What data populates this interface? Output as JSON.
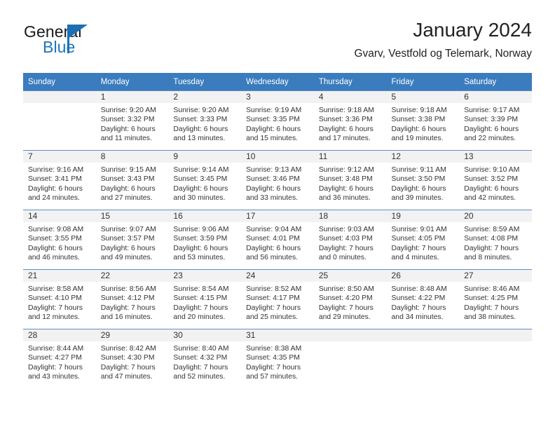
{
  "brand": {
    "name_part1": "General",
    "name_part2": "Blue",
    "logo_icon": "triangle-flag-icon",
    "accent_color": "#1b6fb5"
  },
  "header": {
    "title": "January 2024",
    "subtitle": "Gvarv, Vestfold og Telemark, Norway"
  },
  "theme": {
    "header_row_bg": "#3a7cbe",
    "daynum_band_bg": "#f2f2f2",
    "grid_line": "#5f8fc4",
    "text": "#333333"
  },
  "weekday_headers": [
    "Sunday",
    "Monday",
    "Tuesday",
    "Wednesday",
    "Thursday",
    "Friday",
    "Saturday"
  ],
  "weeks": [
    [
      {
        "day": "",
        "sunrise": "",
        "sunset": "",
        "daylight_line1": "",
        "daylight_line2": "",
        "empty": true
      },
      {
        "day": "1",
        "sunrise": "Sunrise: 9:20 AM",
        "sunset": "Sunset: 3:32 PM",
        "daylight_line1": "Daylight: 6 hours",
        "daylight_line2": "and 11 minutes.",
        "empty": false
      },
      {
        "day": "2",
        "sunrise": "Sunrise: 9:20 AM",
        "sunset": "Sunset: 3:33 PM",
        "daylight_line1": "Daylight: 6 hours",
        "daylight_line2": "and 13 minutes.",
        "empty": false
      },
      {
        "day": "3",
        "sunrise": "Sunrise: 9:19 AM",
        "sunset": "Sunset: 3:35 PM",
        "daylight_line1": "Daylight: 6 hours",
        "daylight_line2": "and 15 minutes.",
        "empty": false
      },
      {
        "day": "4",
        "sunrise": "Sunrise: 9:18 AM",
        "sunset": "Sunset: 3:36 PM",
        "daylight_line1": "Daylight: 6 hours",
        "daylight_line2": "and 17 minutes.",
        "empty": false
      },
      {
        "day": "5",
        "sunrise": "Sunrise: 9:18 AM",
        "sunset": "Sunset: 3:38 PM",
        "daylight_line1": "Daylight: 6 hours",
        "daylight_line2": "and 19 minutes.",
        "empty": false
      },
      {
        "day": "6",
        "sunrise": "Sunrise: 9:17 AM",
        "sunset": "Sunset: 3:39 PM",
        "daylight_line1": "Daylight: 6 hours",
        "daylight_line2": "and 22 minutes.",
        "empty": false
      }
    ],
    [
      {
        "day": "7",
        "sunrise": "Sunrise: 9:16 AM",
        "sunset": "Sunset: 3:41 PM",
        "daylight_line1": "Daylight: 6 hours",
        "daylight_line2": "and 24 minutes.",
        "empty": false
      },
      {
        "day": "8",
        "sunrise": "Sunrise: 9:15 AM",
        "sunset": "Sunset: 3:43 PM",
        "daylight_line1": "Daylight: 6 hours",
        "daylight_line2": "and 27 minutes.",
        "empty": false
      },
      {
        "day": "9",
        "sunrise": "Sunrise: 9:14 AM",
        "sunset": "Sunset: 3:45 PM",
        "daylight_line1": "Daylight: 6 hours",
        "daylight_line2": "and 30 minutes.",
        "empty": false
      },
      {
        "day": "10",
        "sunrise": "Sunrise: 9:13 AM",
        "sunset": "Sunset: 3:46 PM",
        "daylight_line1": "Daylight: 6 hours",
        "daylight_line2": "and 33 minutes.",
        "empty": false
      },
      {
        "day": "11",
        "sunrise": "Sunrise: 9:12 AM",
        "sunset": "Sunset: 3:48 PM",
        "daylight_line1": "Daylight: 6 hours",
        "daylight_line2": "and 36 minutes.",
        "empty": false
      },
      {
        "day": "12",
        "sunrise": "Sunrise: 9:11 AM",
        "sunset": "Sunset: 3:50 PM",
        "daylight_line1": "Daylight: 6 hours",
        "daylight_line2": "and 39 minutes.",
        "empty": false
      },
      {
        "day": "13",
        "sunrise": "Sunrise: 9:10 AM",
        "sunset": "Sunset: 3:52 PM",
        "daylight_line1": "Daylight: 6 hours",
        "daylight_line2": "and 42 minutes.",
        "empty": false
      }
    ],
    [
      {
        "day": "14",
        "sunrise": "Sunrise: 9:08 AM",
        "sunset": "Sunset: 3:55 PM",
        "daylight_line1": "Daylight: 6 hours",
        "daylight_line2": "and 46 minutes.",
        "empty": false
      },
      {
        "day": "15",
        "sunrise": "Sunrise: 9:07 AM",
        "sunset": "Sunset: 3:57 PM",
        "daylight_line1": "Daylight: 6 hours",
        "daylight_line2": "and 49 minutes.",
        "empty": false
      },
      {
        "day": "16",
        "sunrise": "Sunrise: 9:06 AM",
        "sunset": "Sunset: 3:59 PM",
        "daylight_line1": "Daylight: 6 hours",
        "daylight_line2": "and 53 minutes.",
        "empty": false
      },
      {
        "day": "17",
        "sunrise": "Sunrise: 9:04 AM",
        "sunset": "Sunset: 4:01 PM",
        "daylight_line1": "Daylight: 6 hours",
        "daylight_line2": "and 56 minutes.",
        "empty": false
      },
      {
        "day": "18",
        "sunrise": "Sunrise: 9:03 AM",
        "sunset": "Sunset: 4:03 PM",
        "daylight_line1": "Daylight: 7 hours",
        "daylight_line2": "and 0 minutes.",
        "empty": false
      },
      {
        "day": "19",
        "sunrise": "Sunrise: 9:01 AM",
        "sunset": "Sunset: 4:05 PM",
        "daylight_line1": "Daylight: 7 hours",
        "daylight_line2": "and 4 minutes.",
        "empty": false
      },
      {
        "day": "20",
        "sunrise": "Sunrise: 8:59 AM",
        "sunset": "Sunset: 4:08 PM",
        "daylight_line1": "Daylight: 7 hours",
        "daylight_line2": "and 8 minutes.",
        "empty": false
      }
    ],
    [
      {
        "day": "21",
        "sunrise": "Sunrise: 8:58 AM",
        "sunset": "Sunset: 4:10 PM",
        "daylight_line1": "Daylight: 7 hours",
        "daylight_line2": "and 12 minutes.",
        "empty": false
      },
      {
        "day": "22",
        "sunrise": "Sunrise: 8:56 AM",
        "sunset": "Sunset: 4:12 PM",
        "daylight_line1": "Daylight: 7 hours",
        "daylight_line2": "and 16 minutes.",
        "empty": false
      },
      {
        "day": "23",
        "sunrise": "Sunrise: 8:54 AM",
        "sunset": "Sunset: 4:15 PM",
        "daylight_line1": "Daylight: 7 hours",
        "daylight_line2": "and 20 minutes.",
        "empty": false
      },
      {
        "day": "24",
        "sunrise": "Sunrise: 8:52 AM",
        "sunset": "Sunset: 4:17 PM",
        "daylight_line1": "Daylight: 7 hours",
        "daylight_line2": "and 25 minutes.",
        "empty": false
      },
      {
        "day": "25",
        "sunrise": "Sunrise: 8:50 AM",
        "sunset": "Sunset: 4:20 PM",
        "daylight_line1": "Daylight: 7 hours",
        "daylight_line2": "and 29 minutes.",
        "empty": false
      },
      {
        "day": "26",
        "sunrise": "Sunrise: 8:48 AM",
        "sunset": "Sunset: 4:22 PM",
        "daylight_line1": "Daylight: 7 hours",
        "daylight_line2": "and 34 minutes.",
        "empty": false
      },
      {
        "day": "27",
        "sunrise": "Sunrise: 8:46 AM",
        "sunset": "Sunset: 4:25 PM",
        "daylight_line1": "Daylight: 7 hours",
        "daylight_line2": "and 38 minutes.",
        "empty": false
      }
    ],
    [
      {
        "day": "28",
        "sunrise": "Sunrise: 8:44 AM",
        "sunset": "Sunset: 4:27 PM",
        "daylight_line1": "Daylight: 7 hours",
        "daylight_line2": "and 43 minutes.",
        "empty": false
      },
      {
        "day": "29",
        "sunrise": "Sunrise: 8:42 AM",
        "sunset": "Sunset: 4:30 PM",
        "daylight_line1": "Daylight: 7 hours",
        "daylight_line2": "and 47 minutes.",
        "empty": false
      },
      {
        "day": "30",
        "sunrise": "Sunrise: 8:40 AM",
        "sunset": "Sunset: 4:32 PM",
        "daylight_line1": "Daylight: 7 hours",
        "daylight_line2": "and 52 minutes.",
        "empty": false
      },
      {
        "day": "31",
        "sunrise": "Sunrise: 8:38 AM",
        "sunset": "Sunset: 4:35 PM",
        "daylight_line1": "Daylight: 7 hours",
        "daylight_line2": "and 57 minutes.",
        "empty": false
      },
      {
        "day": "",
        "sunrise": "",
        "sunset": "",
        "daylight_line1": "",
        "daylight_line2": "",
        "empty": true
      },
      {
        "day": "",
        "sunrise": "",
        "sunset": "",
        "daylight_line1": "",
        "daylight_line2": "",
        "empty": true
      },
      {
        "day": "",
        "sunrise": "",
        "sunset": "",
        "daylight_line1": "",
        "daylight_line2": "",
        "empty": true
      }
    ]
  ]
}
